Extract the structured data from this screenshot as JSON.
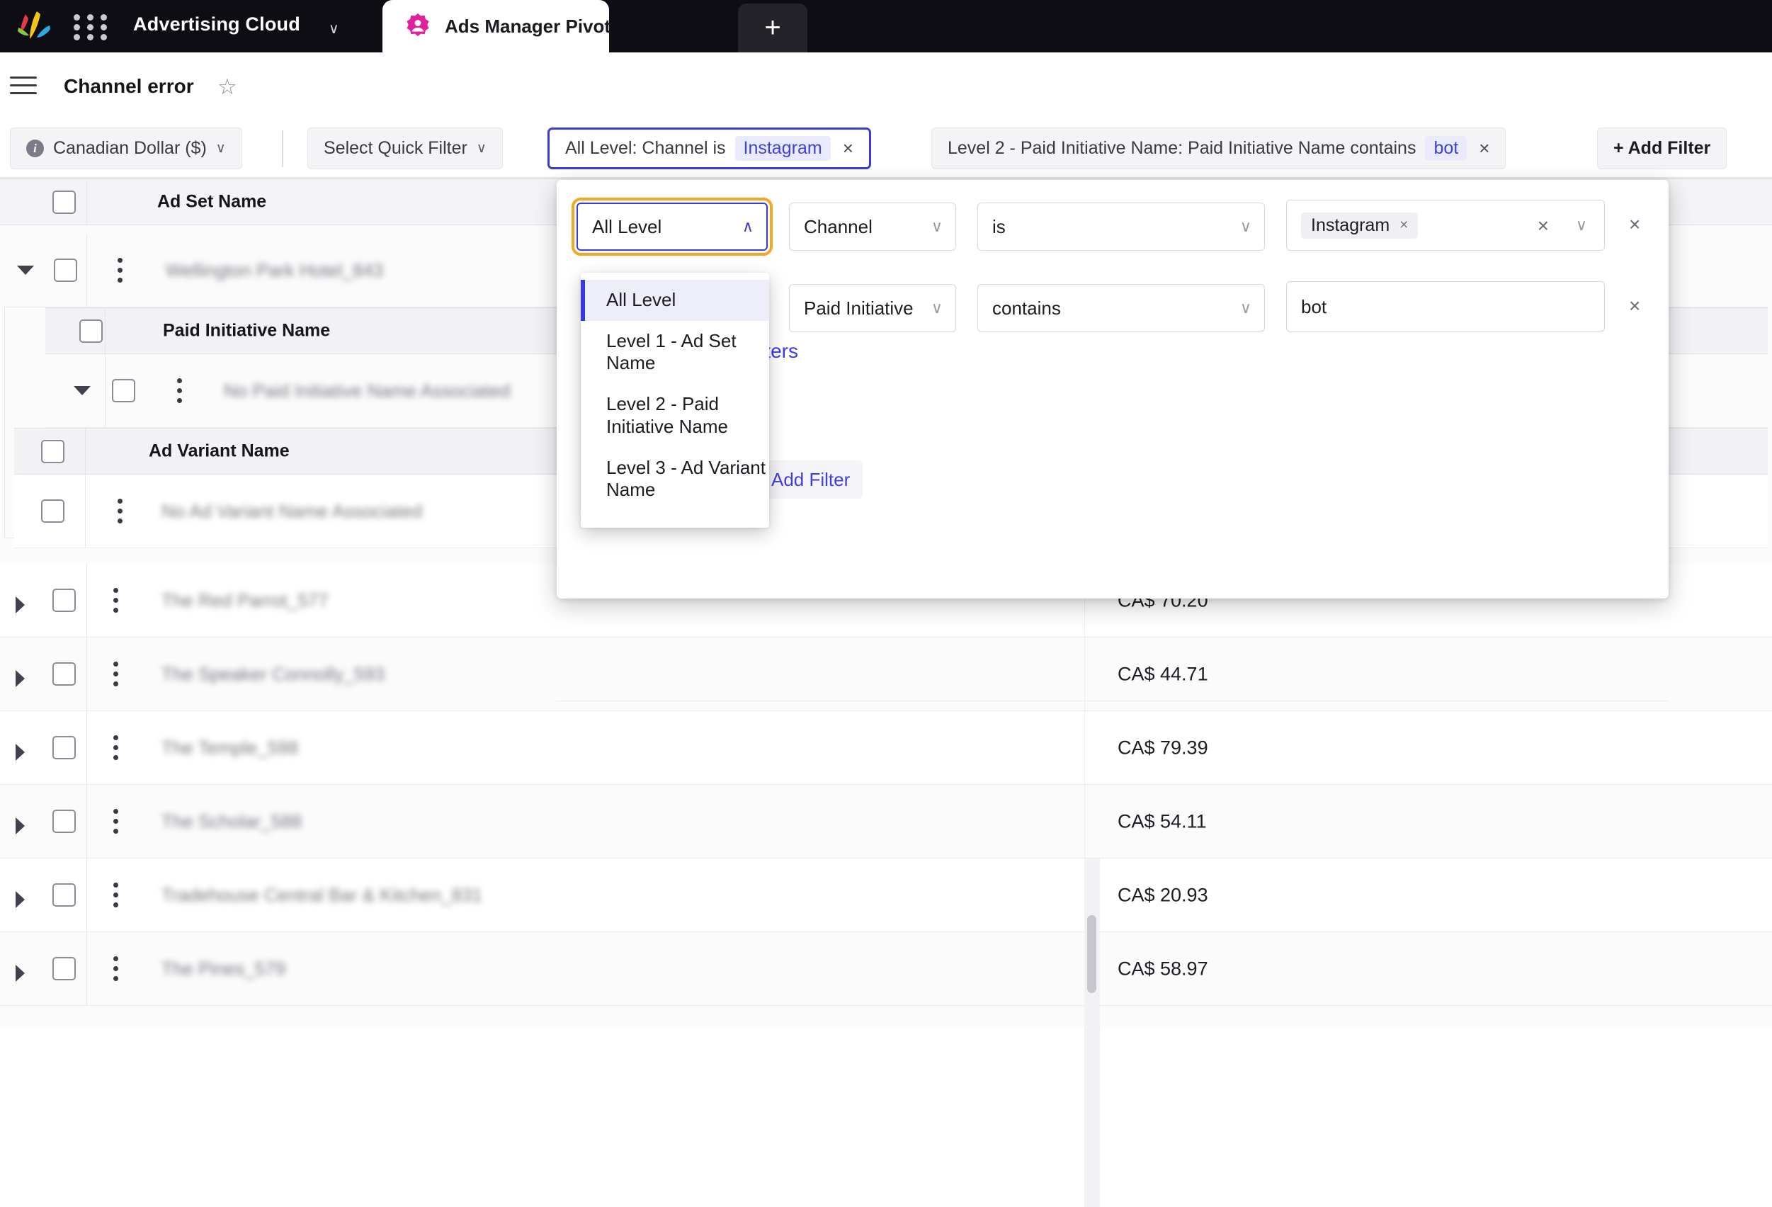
{
  "topbar": {
    "logo_icon": "adobe-logo-icon",
    "grid_icon": "app-grid-icon",
    "brand": "Advertising Cloud",
    "brand_caret": "∨",
    "tab": {
      "label": "Ads Manager Pivot",
      "icon": "ads-manager-icon"
    },
    "new_tab": "+"
  },
  "titlebar": {
    "menu_icon": "hamburger-menu-icon",
    "title": "Channel error",
    "favorite_icon": "☆"
  },
  "filterbar": {
    "currency": "Canadian Dollar ($)",
    "quick_filter": "Select Quick Filter",
    "filter1": {
      "prefix": "All Level: Channel is",
      "token": "Instagram",
      "close": "×"
    },
    "filter2": {
      "prefix": "Level 2 - Paid Initiative Name: Paid Initiative Name contains",
      "token": "bot",
      "close": "×"
    },
    "add_filter": "+ Add Filter",
    "caret": "∨"
  },
  "panel": {
    "row1": {
      "level": "All Level",
      "level_caret": "∧",
      "field": "Channel",
      "operator": "is",
      "value_chip": "Instagram",
      "chip_close": "×",
      "clear": "×",
      "caret": "∨",
      "remove": "×"
    },
    "row2": {
      "field": "Paid Initiative",
      "operator": "contains",
      "value": "bot",
      "remove": "×",
      "caret": "∨"
    },
    "add_filter": "+ Add Filter",
    "switch_link": "Switch to Simple Filters",
    "dropdown": {
      "options": [
        "All Level",
        "Level 1 - Ad Set Name",
        "Level 2 - Paid Initiative Name",
        "Level 3 - Ad Variant Name"
      ],
      "selected": "All Level"
    }
  },
  "table": {
    "columns": {
      "ad_set_name": "Ad Set Name",
      "paid_initiative_name": "Paid Initiative Name",
      "ad_variant_name": "Ad Variant Name"
    },
    "rows": [
      {
        "name": "Wellington Park Hotel_843",
        "expanded": true,
        "level": 1,
        "cost": ""
      },
      {
        "name": "No Paid Initiative Name Associated",
        "expanded": true,
        "level": 2,
        "cost": ""
      },
      {
        "name": "No Ad Variant Name Associated",
        "expanded": false,
        "level": 3,
        "cost": ""
      },
      {
        "name": "The Red Parrot_577",
        "expanded": false,
        "level": 1,
        "cost": "CA$ 70.20"
      },
      {
        "name": "The Speaker Connolly_593",
        "expanded": false,
        "level": 1,
        "cost": "CA$ 44.71"
      },
      {
        "name": "The Temple_598",
        "expanded": false,
        "level": 1,
        "cost": "CA$ 79.39"
      },
      {
        "name": "The Scholar_588",
        "expanded": false,
        "level": 1,
        "cost": "CA$ 54.11"
      },
      {
        "name": "Tradehouse Central Bar & Kitchen_831",
        "expanded": false,
        "level": 1,
        "cost": "CA$ 20.93"
      },
      {
        "name": "The Pines_579",
        "expanded": false,
        "level": 1,
        "cost": "CA$ 58.97"
      }
    ]
  },
  "colors": {
    "brand_dark": "#0d0d13",
    "accent_blue": "#3b3bdb",
    "focus_orange": "#f5a623",
    "tab_pink": "#e0219b"
  }
}
